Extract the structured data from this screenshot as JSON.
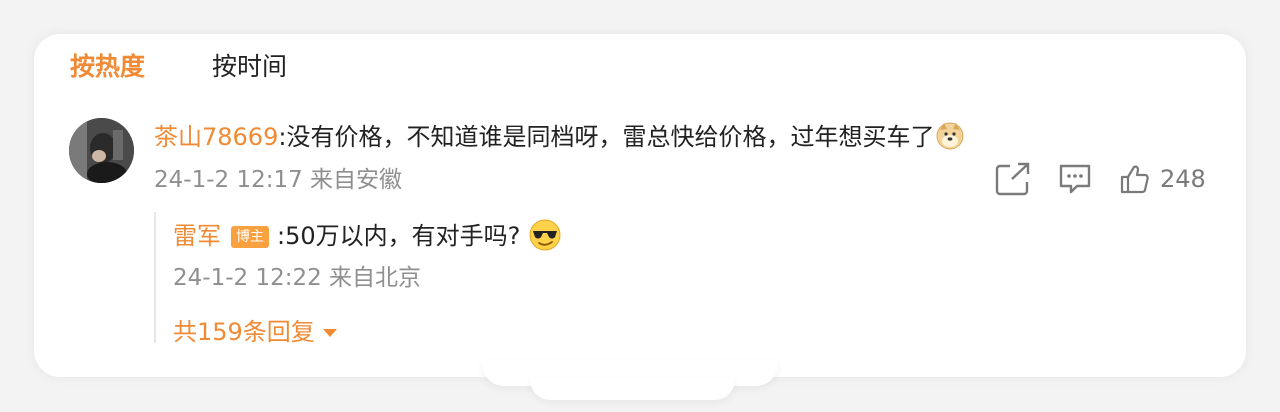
{
  "sort_tabs": {
    "hot": "按热度",
    "time": "按时间"
  },
  "comment": {
    "user": "茶山78669",
    "text": ":没有价格，不知道谁是同档呀，雷总快给价格，过年想买车了",
    "time": "24-1-2 12:17",
    "location": "来自安徽",
    "likes": "248",
    "emoji_icon": "doge-icon"
  },
  "reply": {
    "user": "雷军",
    "badge": "博主",
    "text": ":50万以内，有对手吗?",
    "time": "24-1-2 12:22",
    "location": "来自北京",
    "emoji_icon": "sunglasses-emoji-icon"
  },
  "more_replies": {
    "label": "共159条回复"
  },
  "colors": {
    "accent": "#f08a34",
    "badge": "#f9a03f",
    "muted": "#8f8f8f"
  }
}
